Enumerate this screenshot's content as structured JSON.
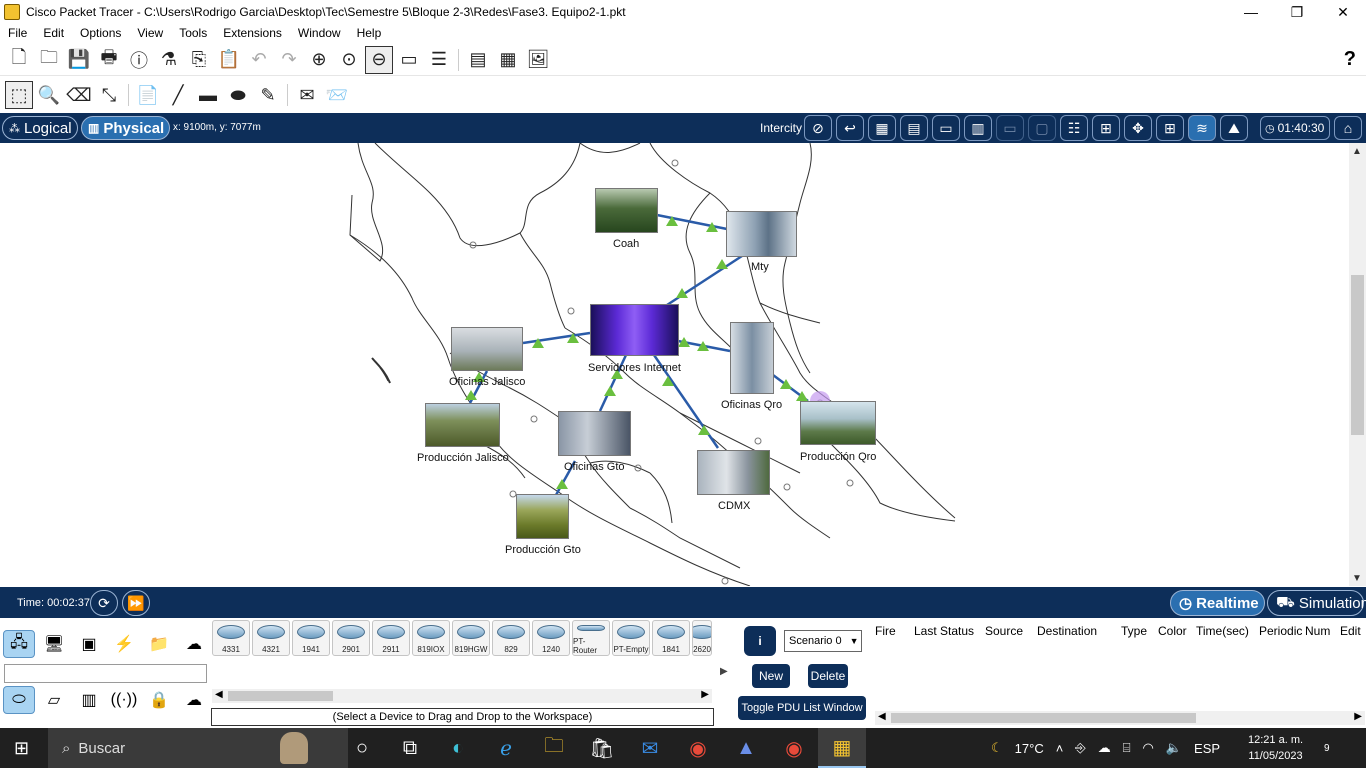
{
  "window": {
    "title": "Cisco Packet Tracer - C:\\Users\\Rodrigo Garcia\\Desktop\\Tec\\Semestre 5\\Bloque 2-3\\Redes\\Fase3. Equipo2-1.pkt",
    "minimize": "—",
    "restore": "❐",
    "close": "✕"
  },
  "menu": [
    "File",
    "Edit",
    "Options",
    "View",
    "Tools",
    "Extensions",
    "Window",
    "Help"
  ],
  "toolbar1": {
    "icons": [
      "new-icon",
      "open-icon",
      "save-icon",
      "print-icon",
      "info-icon",
      "wizard-icon",
      "copy-icon",
      "paste-icon",
      "undo-icon",
      "redo-icon",
      "zoom-in-icon",
      "zoom-reset-icon",
      "zoom-out-icon",
      "drawing-palette-icon",
      "custom-devices-icon",
      "viewport-icon",
      "cluster-icon",
      "pc-image-icon"
    ],
    "help": "?"
  },
  "toolbar2": {
    "icons": [
      "select-icon",
      "inspect-icon",
      "delete-icon",
      "resize-icon",
      "note-icon",
      "line-icon",
      "rectangle-icon",
      "ellipse-icon",
      "freeform-icon",
      "simple-pdu-icon",
      "complex-pdu-icon"
    ]
  },
  "modebar": {
    "logical": "Logical",
    "physical": "Physical",
    "coords": "x: 9100m, y: 7077m",
    "location": "Intercity",
    "time": "01:40:30"
  },
  "map": {
    "nodes": [
      {
        "id": "coah",
        "label": "Coah"
      },
      {
        "id": "mty",
        "label": "Mty"
      },
      {
        "id": "servidores",
        "label": "Servidores Internet"
      },
      {
        "id": "of-jalisco",
        "label": "Oficinas Jalisco"
      },
      {
        "id": "of-qro",
        "label": "Oficinas Qro"
      },
      {
        "id": "prod-jalisco",
        "label": "Producción Jalisco"
      },
      {
        "id": "of-gto",
        "label": "Oficinas Gto"
      },
      {
        "id": "prod-qro",
        "label": "Producción Qro"
      },
      {
        "id": "cdmx",
        "label": "CDMX"
      },
      {
        "id": "prod-gto",
        "label": "Producción Gto"
      }
    ],
    "link_color": "#2a5ba8",
    "link_up_color": "#6abf3f"
  },
  "status": {
    "time_label": "Time: 00:02:37",
    "realtime": "Realtime",
    "simulation": "Simulation"
  },
  "devices": [
    "4331",
    "4321",
    "1941",
    "2901",
    "2911",
    "819IOX",
    "819HGW",
    "829",
    "1240",
    "PT-Router",
    "PT-Empty",
    "1841",
    "2620"
  ],
  "bottom": {
    "hint": "(Select a Device to Drag and Drop to the Workspace)",
    "info": "i",
    "scenario": "Scenario 0",
    "new": "New",
    "delete": "Delete",
    "toggle": "Toggle PDU List Window",
    "pdu_columns": [
      "Fire",
      "Last Status",
      "Source",
      "Destination",
      "Type",
      "Color",
      "Time(sec)",
      "Periodic",
      "Num",
      "Edit"
    ]
  },
  "taskbar": {
    "search": "Buscar",
    "temp": "17°C",
    "lang": "ESP",
    "clock_time": "12:21 a. m.",
    "clock_date": "11/05/2023",
    "notif_count": "9"
  }
}
